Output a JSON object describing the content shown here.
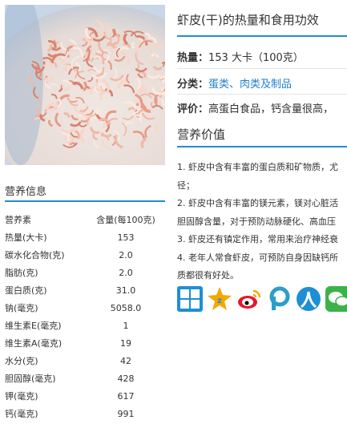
{
  "header": {
    "title": "虾皮(干)的热量和食用功效"
  },
  "info": {
    "calorie_label": "热量：",
    "calorie_value": "153 大卡（100克）",
    "category_label": "分类：",
    "category_links": [
      "蛋类、肉类及制品"
    ],
    "rating_label": "评价：",
    "rating_value": "高蛋白食品，钙含量很高，"
  },
  "nutrition": {
    "title": "营养信息",
    "header": {
      "name": "营养素",
      "amount": "含量(每100克)"
    },
    "rows": [
      {
        "name": "热量(大卡)",
        "amount": "153"
      },
      {
        "name": "碳水化合物(克)",
        "amount": "2.0"
      },
      {
        "name": "脂肪(克)",
        "amount": "2.0"
      },
      {
        "name": "蛋白质(克)",
        "amount": "31.0"
      },
      {
        "name": "钠(毫克)",
        "amount": "5058.0"
      },
      {
        "name": "维生素E(毫克)",
        "amount": "1"
      },
      {
        "name": "维生素A(毫克)",
        "amount": "19"
      },
      {
        "name": "水分(克)",
        "amount": "42"
      },
      {
        "name": "胆固醇(毫克)",
        "amount": "428"
      },
      {
        "name": "钾(毫克)",
        "amount": "617"
      },
      {
        "name": "钙(毫克)",
        "amount": "991"
      }
    ]
  },
  "value": {
    "title": "营养价值",
    "lines": [
      "1. 虾皮中含有丰富的蛋白质和矿物质，尤",
      "径；",
      "2. 虾皮中含有丰富的镁元素，镁对心脏活",
      "胆固醇含量，对于预防动脉硬化、高血压",
      "3. 虾皮还有镇定作用，常用来治疗神经衰",
      "4. 老年人常食虾皮，可预防自身因缺钙所",
      "质都很有好处。"
    ]
  },
  "share": {
    "icons": [
      "qzone-plus-icon",
      "qzone-star-icon",
      "weibo-icon",
      "pengyou-icon",
      "renren-icon",
      "wechat-icon"
    ],
    "colors": {
      "blue": "#1e8fd4",
      "orange": "#f5a800",
      "red": "#e6162d",
      "teal": "#2a9fc7",
      "green": "#3bb34a"
    }
  },
  "colors": {
    "accent": "#1e8fd4",
    "link": "#1e7fc8"
  }
}
